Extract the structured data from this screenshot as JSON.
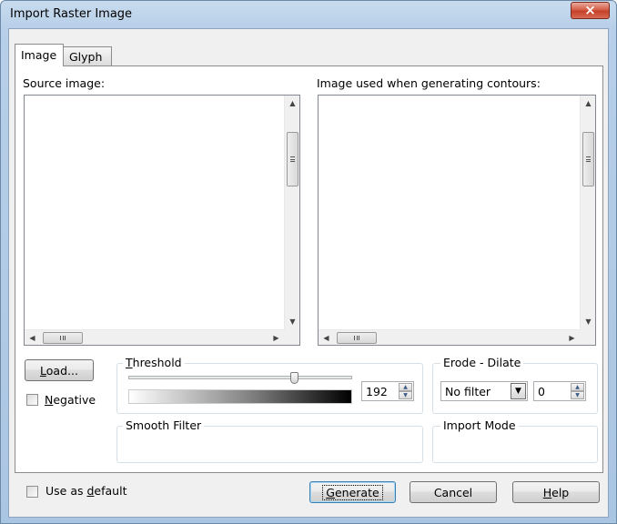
{
  "window": {
    "title": "Import Raster Image",
    "close_glyph": "×"
  },
  "tabs": [
    {
      "label": "Image"
    },
    {
      "label": "Glyph"
    }
  ],
  "source_panel": {
    "label": "Source image:"
  },
  "generated_panel": {
    "label": "Image used when generating contours:"
  },
  "load_button": {
    "prefix": "",
    "mnemonic": "L",
    "suffix": "oad..."
  },
  "negative": {
    "mnemonic": "N",
    "suffix": "egative",
    "checked": false
  },
  "threshold": {
    "mnemonic": "T",
    "suffix": "hreshold",
    "value": "192",
    "level": 0.75
  },
  "erode_dilate": {
    "title": "Erode - Dilate",
    "filter": "No filter",
    "amount": "0"
  },
  "smooth_filter": {
    "title": "Smooth Filter"
  },
  "import_mode": {
    "title": "Import Mode"
  },
  "use_default": {
    "prefix": "Use as ",
    "mnemonic": "d",
    "suffix": "efault",
    "checked": false
  },
  "buttons": {
    "generate": {
      "mnemonic": "G",
      "suffix": "enerate"
    },
    "cancel": {
      "label": "Cancel"
    },
    "help": {
      "mnemonic": "H",
      "suffix": "elp"
    }
  },
  "icons": {
    "arrow_up": "▲",
    "arrow_down": "▼",
    "arrow_left": "◀",
    "arrow_right": "▶"
  },
  "colors": {
    "title_bar": "#b9d1ea",
    "close_button": "#c9452e",
    "dialog_bg": "#f0f0f0",
    "default_button_border": "#3c7fb1"
  }
}
